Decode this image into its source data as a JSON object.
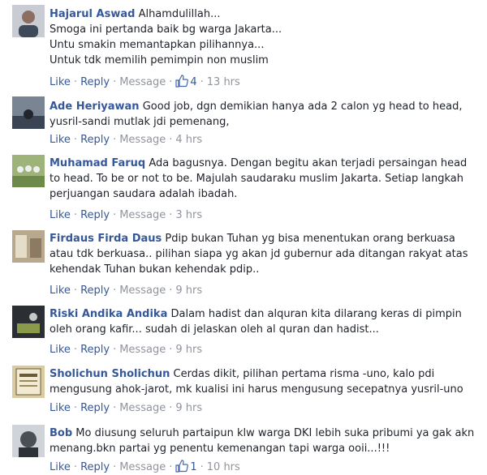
{
  "actions": {
    "like": "Like",
    "reply": "Reply",
    "message": "Message",
    "sep": "·"
  },
  "colors": {
    "link": "#365899",
    "meta": "#90949c",
    "text": "#1d2129"
  },
  "comments": [
    {
      "author": "Hajarul Aswad",
      "lines": [
        "Alhamdulillah...",
        "Smoga ini pertanda baik bg warga Jakarta...",
        "Untu smakin memantapkan pilihannya...",
        "Untuk tdk memilih pemimpin non muslim"
      ],
      "likes": "4",
      "time": "13 hrs",
      "avatar_icon": "user-photo"
    },
    {
      "author": "Ade Heriyawan",
      "lines": [
        "Good job, dgn demikian hanya ada 2 calon yg head to head,",
        "yusril-sandi mutlak jdi pemenang,"
      ],
      "time": "4 hrs",
      "avatar_icon": "user-photo"
    },
    {
      "author": "Muhamad Faruq",
      "lines": [
        "Ada bagusnya. Dengan begitu akan terjadi persaingan head",
        "to head. To be or not to be. Majulah saudaraku muslim Jakarta. Setiap langkah",
        "perjuangan saudara adalah ibadah."
      ],
      "time": "3 hrs",
      "avatar_icon": "user-photo"
    },
    {
      "author": "Firdaus Firda Daus",
      "lines": [
        "Pdip bukan Tuhan yg bisa menentukan orang berkuasa",
        "atau tdk berkuasa.. pilihan siapa yg akan jd gubernur ada ditangan rakyat atas",
        "kehendak Tuhan bukan kehendak pdip.."
      ],
      "time": "9 hrs",
      "avatar_icon": "user-photo"
    },
    {
      "author": "Riski Andika Andika",
      "lines": [
        "Dalam hadist dan alquran kita dilarang keras di pimpin",
        "oleh orang kafir... sudah di jelaskan oleh al quran dan hadist..."
      ],
      "time": "9 hrs",
      "avatar_icon": "user-photo"
    },
    {
      "author": "Sholichun Sholichun",
      "lines": [
        "Cerdas dikit, pilihan pertama risma -uno, kalo pdi",
        "mengusung ahok-jarot, mk kualisi ini harus mengusung secepatnya yusril-uno"
      ],
      "time": "9 hrs",
      "avatar_icon": "user-photo"
    },
    {
      "author": "Bob",
      "lines": [
        "Mo diusung seluruh partaipun klw warga DKI lebih suka pribumi ya gak akn",
        "menang.bkn partai yg penentu kemenangan tapi warga ooii...!!!"
      ],
      "likes": "1",
      "time": "10 hrs",
      "avatar_icon": "user-photo"
    }
  ]
}
